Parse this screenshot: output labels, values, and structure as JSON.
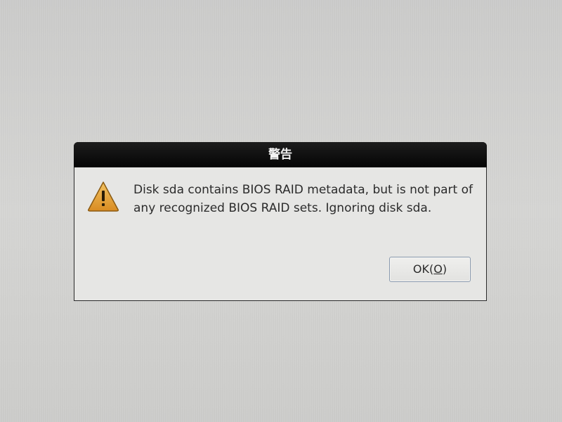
{
  "dialog": {
    "title": "警告",
    "icon": "warning-triangle-icon",
    "message": "Disk sda contains BIOS RAID metadata, but is not part of any recognized BIOS RAID sets. Ignoring disk sda.",
    "ok_button": {
      "label_prefix": "OK(",
      "mnemonic": "O",
      "label_suffix": ")"
    }
  },
  "colors": {
    "titlebar": "#0a0a0a",
    "dialog_bg": "#e6e6e4",
    "warning_fill": "#e8a43a",
    "button_border": "#8a9aae"
  }
}
